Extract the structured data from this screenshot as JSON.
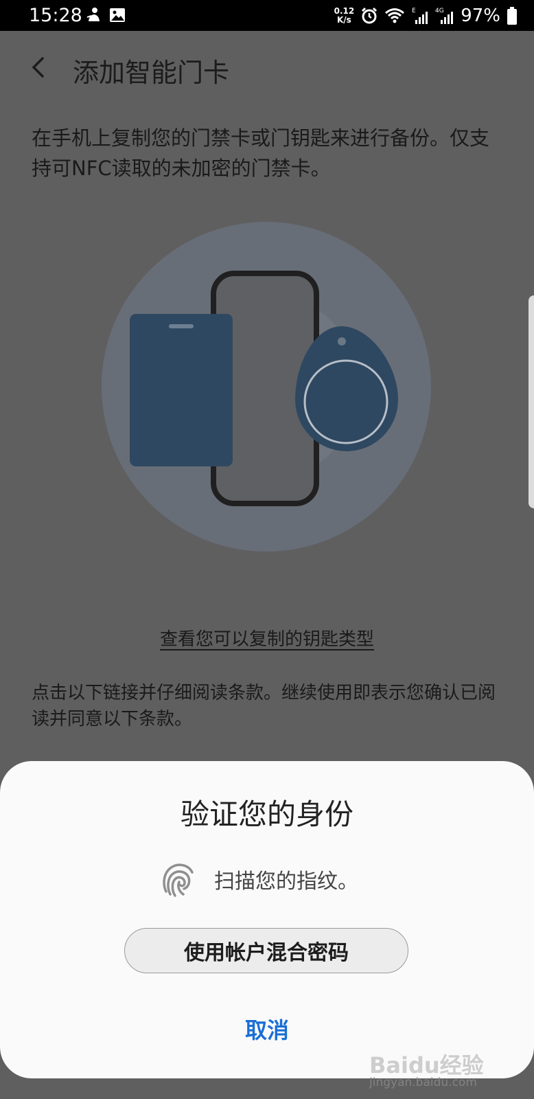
{
  "status_bar": {
    "time": "15:28",
    "net_speed_value": "0.12",
    "net_speed_unit": "K/s",
    "battery": "97%",
    "icons": [
      "notification-icon",
      "gallery-icon",
      "alarm-icon",
      "wifi-icon",
      "signal-e-icon",
      "signal-4g-icon",
      "battery-icon"
    ]
  },
  "header": {
    "back_icon": "chevron-left-icon",
    "title": "添加智能门卡"
  },
  "main": {
    "intro": "在手机上复制您的门禁卡或门钥匙来进行备份。仅支持可NFC读取的未加密的门禁卡。",
    "key_types_link": "查看您可以复制的钥匙类型",
    "terms": "点击以下链接并仔细阅读条款。继续使用即表示您确认已阅读并同意以下条款。"
  },
  "dialog": {
    "title": "验证您的身份",
    "fingerprint_icon": "fingerprint-icon",
    "prompt": "扫描您的指纹。",
    "password_button": "使用帐户混合密码",
    "cancel_button": "取消"
  },
  "watermark": {
    "logo": "Baidu经验",
    "url": "jingyan.baidu.com"
  },
  "colors": {
    "dim_background": "#5f5f60",
    "dialog_background": "#fafafa",
    "accent": "#1a6fd4",
    "card_blue": "#2f4861"
  }
}
